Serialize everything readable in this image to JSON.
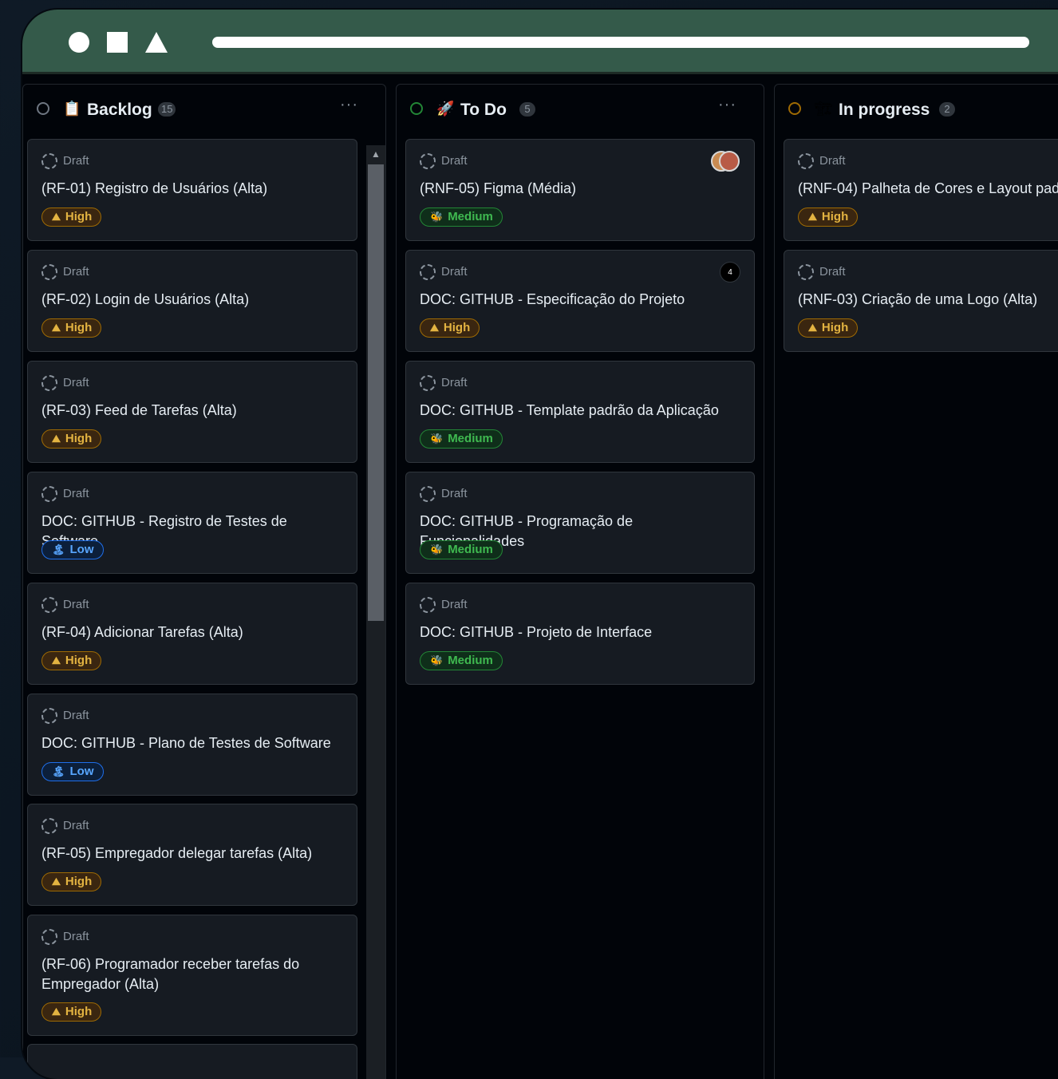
{
  "columns": [
    {
      "title": "Backlog",
      "emoji": "📋",
      "count": "15",
      "status_color": "#6e7681",
      "menu": "···",
      "cards": [
        {
          "status": "Draft",
          "title": "(RF-01) Registro de Usuários (Alta)",
          "priority": "High",
          "priority_icon": "⛰"
        },
        {
          "status": "Draft",
          "title": "(RF-02) Login de Usuários (Alta)",
          "priority": "High",
          "priority_icon": "⛰"
        },
        {
          "status": "Draft",
          "title": "(RF-03) Feed de Tarefas (Alta)",
          "priority": "High",
          "priority_icon": "⛰"
        },
        {
          "status": "Draft",
          "title": "DOC: GITHUB - Registro de Testes de Software",
          "priority": "Low",
          "priority_icon": "🏝"
        },
        {
          "status": "Draft",
          "title": "(RF-04) Adicionar Tarefas (Alta)",
          "priority": "High",
          "priority_icon": "⛰"
        },
        {
          "status": "Draft",
          "title": "DOC: GITHUB - Plano de Testes de Software",
          "priority": "Low",
          "priority_icon": "🏝"
        },
        {
          "status": "Draft",
          "title": "(RF-05) Empregador delegar tarefas (Alta)",
          "priority": "High",
          "priority_icon": "⛰"
        },
        {
          "status": "Draft",
          "title": "(RF-06) Programador receber tarefas do Empregador (Alta)",
          "priority": "High",
          "priority_icon": "⛰"
        }
      ]
    },
    {
      "title": "To Do",
      "emoji": "🚀",
      "count": "5",
      "status_color": "#238636",
      "menu": "···",
      "cards": [
        {
          "status": "Draft",
          "title": "(RNF-05) Figma (Média)",
          "priority": "Medium",
          "priority_icon": "🐝"
        },
        {
          "status": "Draft",
          "title": "DOC: GITHUB - Especificação do Projeto",
          "priority": "High",
          "priority_icon": "⛰",
          "assignee": "4"
        },
        {
          "status": "Draft",
          "title": "DOC: GITHUB - Template padrão da Aplicação",
          "priority": "Medium",
          "priority_icon": "🐝"
        },
        {
          "status": "Draft",
          "title": "DOC: GITHUB - Programação de Funcionalidades",
          "priority": "Medium",
          "priority_icon": "🐝"
        },
        {
          "status": "Draft",
          "title": "DOC: GITHUB - Projeto de Interface",
          "priority": "Medium",
          "priority_icon": "🐝"
        }
      ]
    },
    {
      "title": "In progress",
      "emoji": "🏗",
      "count": "2",
      "status_color": "#9e6a03",
      "cards": [
        {
          "status": "Draft",
          "title": "(RNF-04) Palheta de Cores e Layout padr",
          "priority": "High",
          "priority_icon": "⛰"
        },
        {
          "status": "Draft",
          "title": "(RNF-03) Criação de uma Logo (Alta)",
          "priority": "High",
          "priority_icon": "⛰"
        }
      ]
    }
  ],
  "colors": {
    "chrome": "#345a4a",
    "board_bg": "#010409",
    "card_bg": "#161b22",
    "high": "#e3b341",
    "medium": "#3fb950",
    "low": "#58a6ff"
  }
}
